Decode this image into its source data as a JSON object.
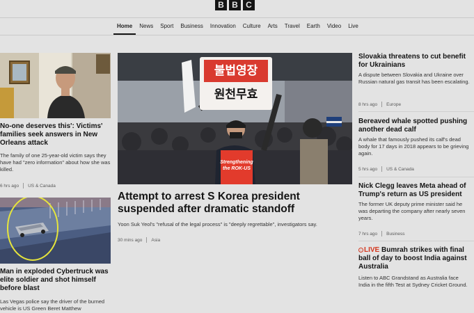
{
  "brand": {
    "letters": [
      "B",
      "B",
      "C"
    ]
  },
  "nav": {
    "items": [
      "Home",
      "News",
      "Sport",
      "Business",
      "Innovation",
      "Culture",
      "Arts",
      "Travel",
      "Earth",
      "Video",
      "Live"
    ],
    "active": "Home"
  },
  "left": {
    "story1": {
      "headline": "No-one deserves this': Victims' families seek answers in New Orleans attack",
      "summary": "The family of one 25-year-old victim says they have had \"zero information\" about how she was killed.",
      "time": "6 hrs ago",
      "section": "US & Canada"
    },
    "story2": {
      "headline": "Man in exploded Cybertruck was elite soldier and shot himself before blast",
      "summary": "Las Vegas police say the driver of the burned vehicle is US Green Beret Matthew"
    }
  },
  "main": {
    "headline": "Attempt to arrest S Korea president suspended after dramatic standoff",
    "summary": "Yoon Suk Yeol's \"refusal of the legal process\" is \"deeply regrettable\", investigators say.",
    "time": "30 mins ago",
    "section": "Asia",
    "sign_line1": "불법영장",
    "sign_line2": "원천무효",
    "banner_text": "Strengthening the ROK-US"
  },
  "right": {
    "items": [
      {
        "headline": "Slovakia threatens to cut benefit for Ukrainians",
        "summary": "A dispute between Slovakia and Ukraine over Russian natural gas transit has been escalating.",
        "time": "8 hrs ago",
        "section": "Europe"
      },
      {
        "headline": "Bereaved whale spotted pushing another dead calf",
        "summary": "A whale that famously pushed its calf's dead body for 17 days in 2018 appears to be grieving again.",
        "time": "5 hrs ago",
        "section": "US & Canada"
      },
      {
        "headline": "Nick Clegg leaves Meta ahead of Trump's return as US president",
        "summary": "The former UK deputy prime minister said he was departing the company after nearly seven years.",
        "time": "7 hrs ago",
        "section": "Business"
      },
      {
        "live_label": "LIVE",
        "headline": "Bumrah strikes with final ball of day to boost India against Australia",
        "summary": "Listen to ABC Grandstand as Australia face India in the fifth Test at Sydney Cricket Ground."
      }
    ]
  }
}
